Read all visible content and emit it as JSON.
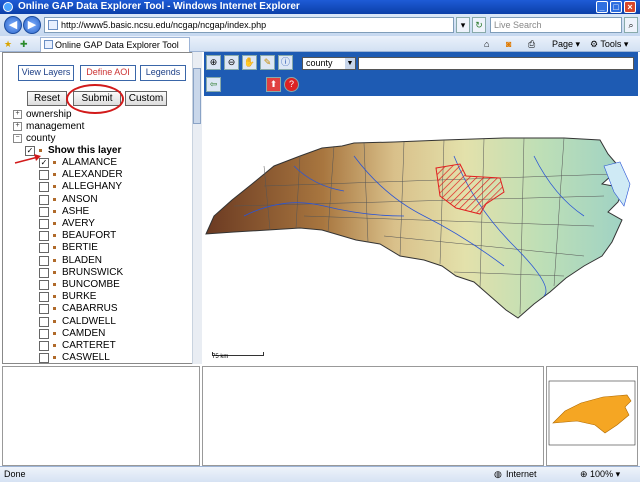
{
  "window": {
    "title": "Online GAP Data Explorer Tool - Windows Internet Explorer"
  },
  "browser": {
    "address": "http://www5.basic.ncsu.edu/ncgap/ncgap/index.php",
    "search_placeholder": "Live Search",
    "tab_title": "Online GAP Data Explorer Tool",
    "toolbar": {
      "page": "Page",
      "tools": "Tools"
    }
  },
  "left_panel": {
    "tabs": [
      "View Layers",
      "Define AOI",
      "Legends"
    ],
    "active_tab": "Define AOI",
    "buttons": {
      "reset": "Reset",
      "submit": "Submit",
      "custom": "Custom"
    },
    "tree": [
      {
        "label": "ownership",
        "expander": "+"
      },
      {
        "label": "management",
        "expander": "+"
      },
      {
        "label": "county",
        "expander": "−"
      }
    ],
    "show_layer_label": "Show this layer",
    "counties": [
      {
        "name": "ALAMANCE",
        "checked": true
      },
      {
        "name": "ALEXANDER",
        "checked": false
      },
      {
        "name": "ALLEGHANY",
        "checked": false
      },
      {
        "name": "ANSON",
        "checked": false
      },
      {
        "name": "ASHE",
        "checked": false
      },
      {
        "name": "AVERY",
        "checked": false
      },
      {
        "name": "BEAUFORT",
        "checked": false
      },
      {
        "name": "BERTIE",
        "checked": false
      },
      {
        "name": "BLADEN",
        "checked": false
      },
      {
        "name": "BRUNSWICK",
        "checked": false
      },
      {
        "name": "BUNCOMBE",
        "checked": false
      },
      {
        "name": "BURKE",
        "checked": false
      },
      {
        "name": "CABARRUS",
        "checked": false
      },
      {
        "name": "CALDWELL",
        "checked": false
      },
      {
        "name": "CAMDEN",
        "checked": false
      },
      {
        "name": "CARTERET",
        "checked": false
      },
      {
        "name": "CASWELL",
        "checked": false
      }
    ]
  },
  "map": {
    "layer_select": "county",
    "scale_label": "75 km",
    "colors": {
      "toolbar": "#1e5bb3",
      "selection": "#e02020",
      "overview": "#f5a623"
    }
  },
  "status_bar": {
    "left": "Done",
    "zone": "Internet",
    "zoom": "100%"
  }
}
